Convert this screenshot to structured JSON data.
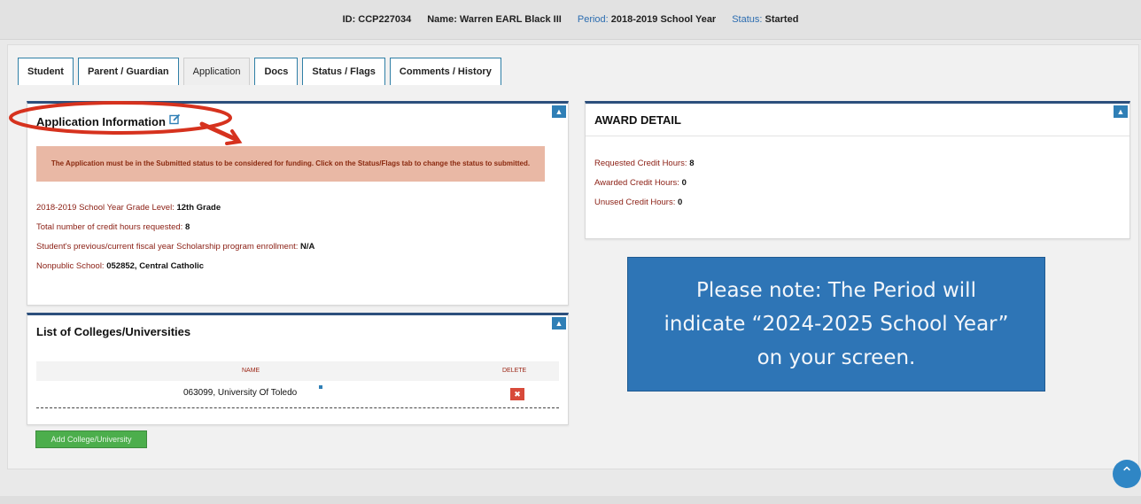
{
  "header": {
    "id_label": "ID:",
    "id_value": "CCP227034",
    "name_label": "Name:",
    "name_value": "Warren EARL Black III",
    "period_label": "Period:",
    "period_value": "2018-2019 School Year",
    "status_label": "Status:",
    "status_value": "Started"
  },
  "tabs": [
    {
      "label": "Student"
    },
    {
      "label": "Parent / Guardian"
    },
    {
      "label": "Application"
    },
    {
      "label": "Docs"
    },
    {
      "label": "Status / Flags"
    },
    {
      "label": "Comments / History"
    }
  ],
  "application_info": {
    "title": "Application Information",
    "edit_icon": "edit-icon",
    "alert": "The Application must be in the Submitted status to be considered for funding. Click on the Status/Flags tab to change the status to submitted.",
    "fields": [
      {
        "label": "2018-2019 School Year Grade Level:",
        "value": "12th Grade"
      },
      {
        "label": "Total number of credit hours requested:",
        "value": "8"
      },
      {
        "label": "Student's previous/current fiscal year Scholarship program enrollment:",
        "value": "N/A"
      },
      {
        "label": "Nonpublic School:",
        "value": "052852, Central Catholic"
      }
    ]
  },
  "award_detail": {
    "title": "AWARD DETAIL",
    "rows": [
      {
        "label": "Requested Credit Hours:",
        "value": "8"
      },
      {
        "label": "Awarded Credit Hours:",
        "value": "0"
      },
      {
        "label": "Unused Credit Hours:",
        "value": "0"
      }
    ]
  },
  "colleges": {
    "title": "List of Colleges/Universities",
    "columns": [
      "NAME",
      "DELETE"
    ],
    "rows": [
      {
        "name": "063099, University Of Toledo"
      }
    ],
    "add_button": "Add College/University"
  },
  "note": {
    "text": "Please note: The Period will indicate “2024-2025 School Year” on your screen."
  },
  "colors": {
    "accent": "#2e75b6",
    "tab_border": "#2f7fa6",
    "label_red": "#8a1d12",
    "alert_bg": "#e9b8a5",
    "annotation_red": "#d6321e"
  }
}
